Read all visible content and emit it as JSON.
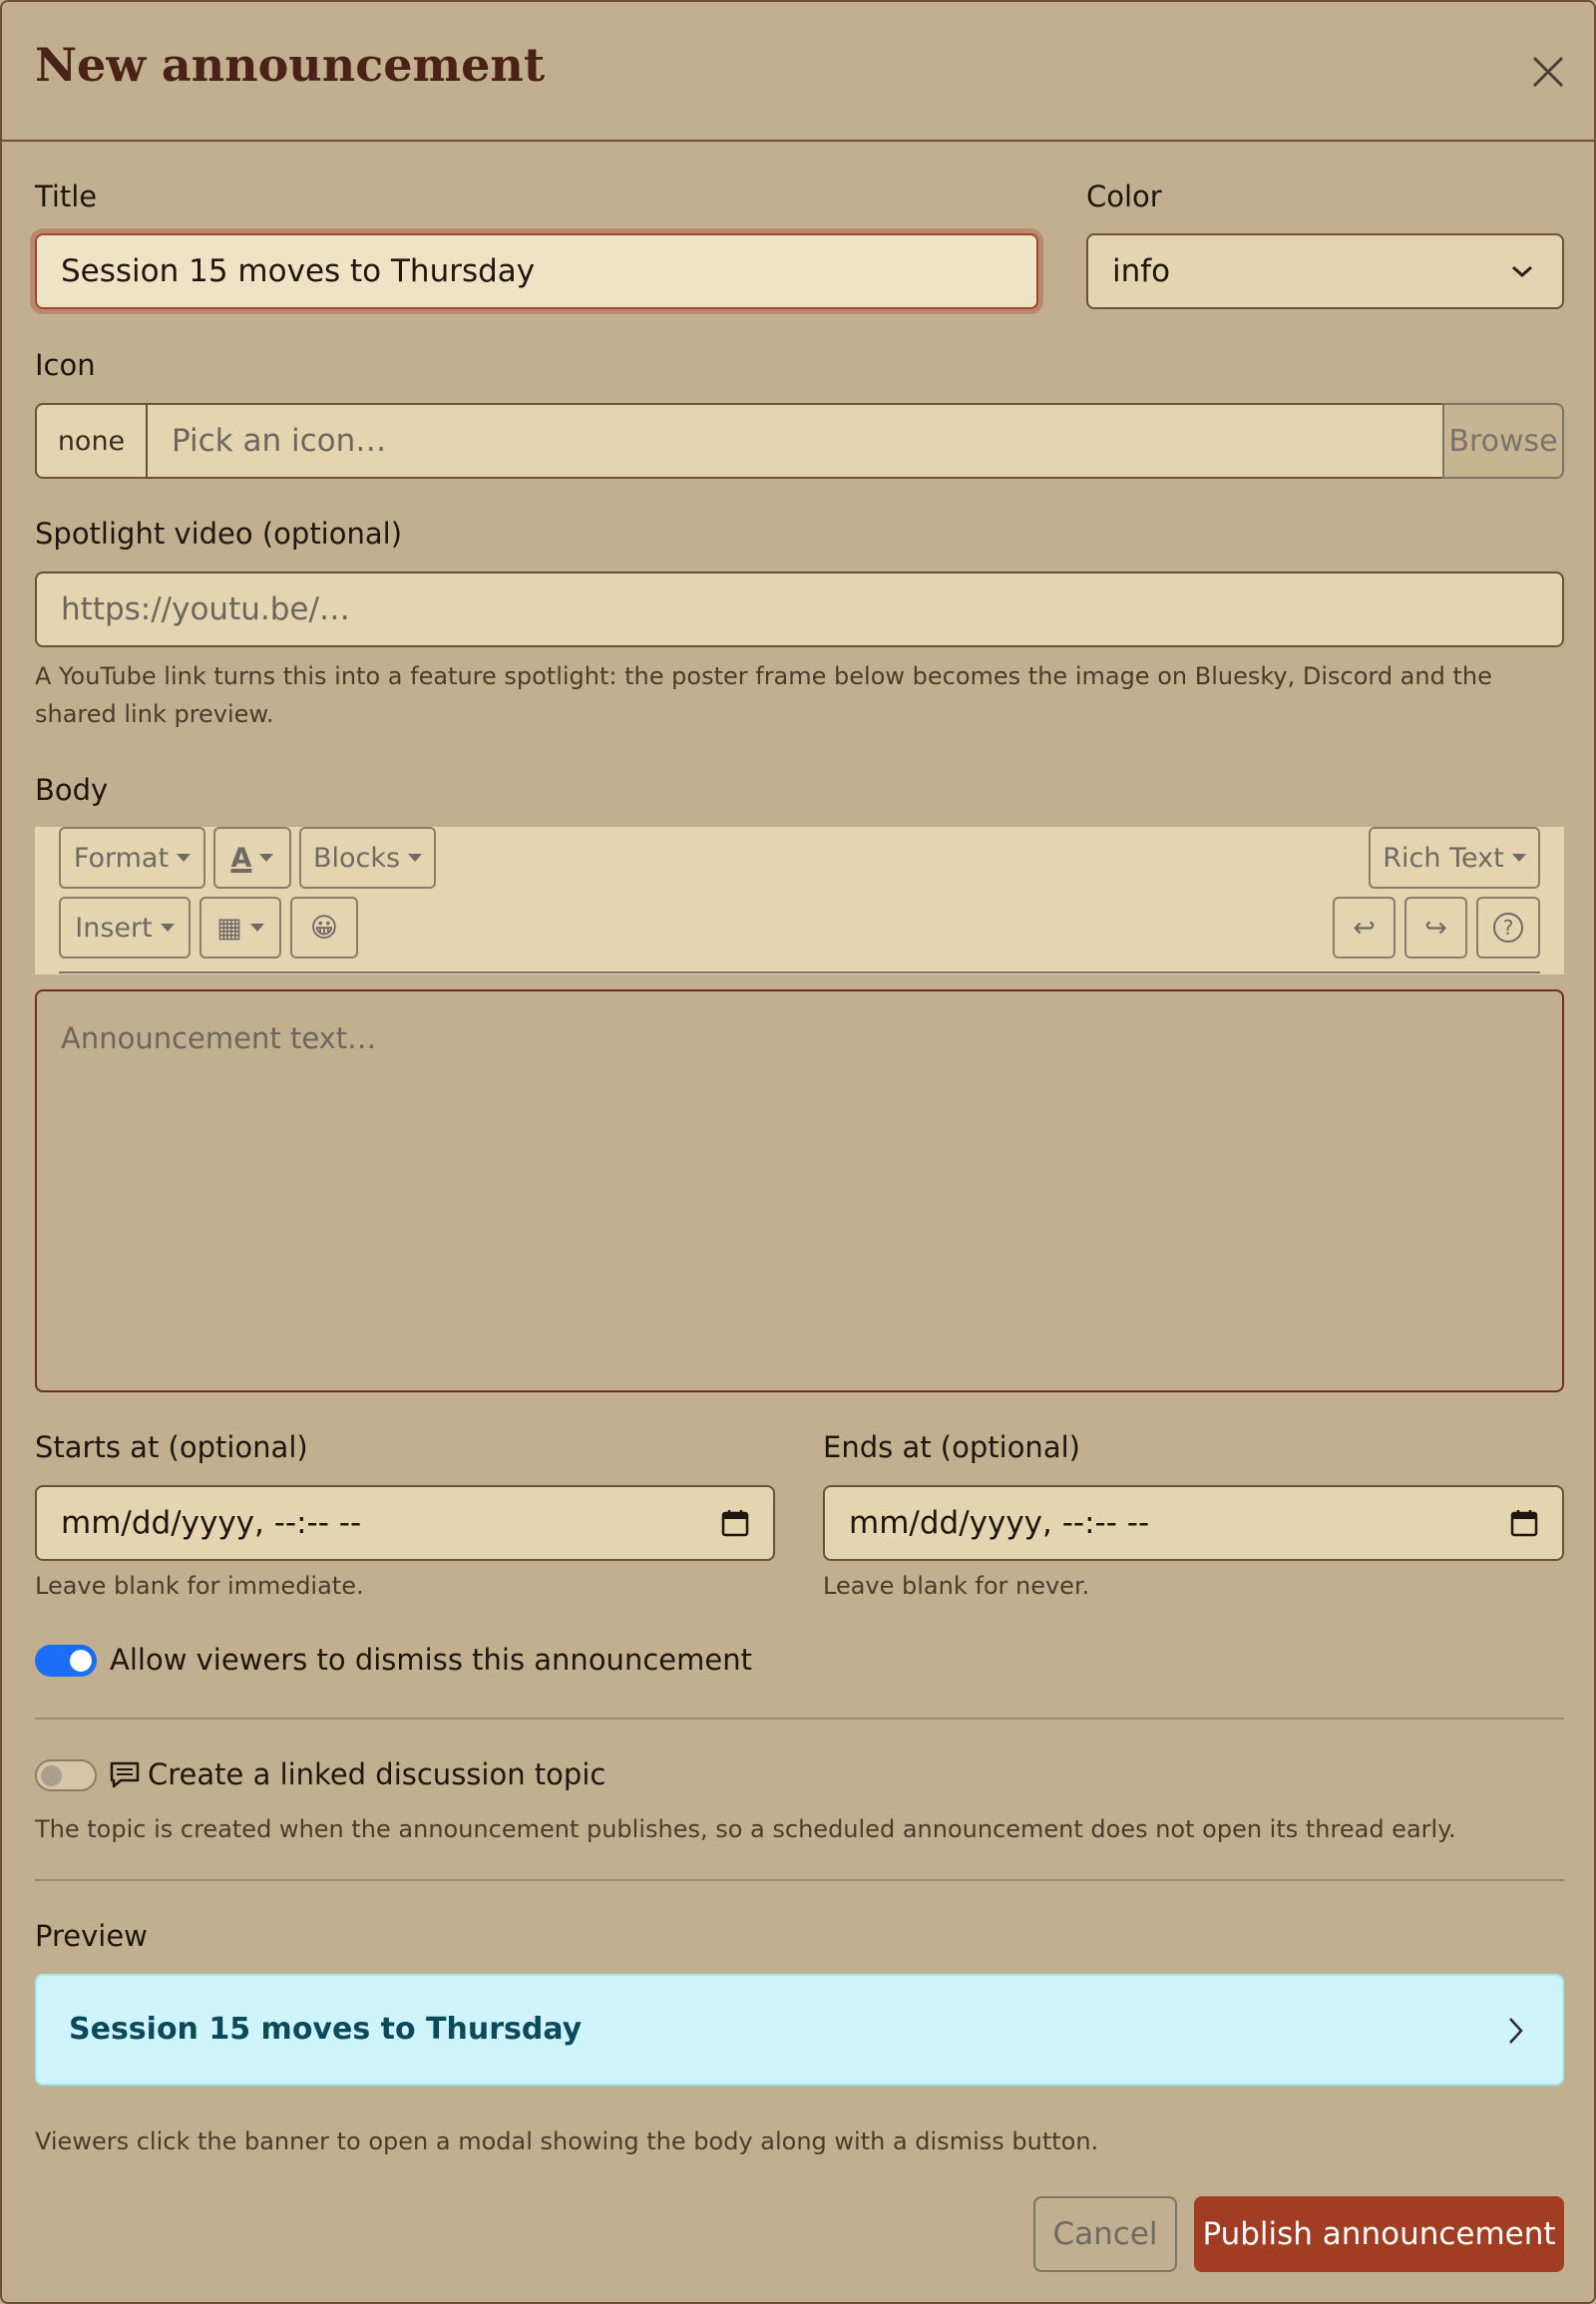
{
  "modal": {
    "title": "New announcement"
  },
  "form": {
    "title_label": "Title",
    "title_value": "Session 15 moves to Thursday",
    "color_label": "Color",
    "color_value": "info",
    "icon_label": "Icon",
    "icon_prefix": "none",
    "icon_placeholder": "Pick an icon…",
    "icon_browse": "Browse",
    "video_label": "Spotlight video (optional)",
    "video_placeholder": "https://youtu.be/…",
    "video_help": "A YouTube link turns this into a feature spotlight: the poster frame below becomes the image on Bluesky, Discord and the shared link preview.",
    "body_label": "Body",
    "body_placeholder": "Announcement text…",
    "starts_label": "Starts at (optional)",
    "starts_value": "mm/dd/yyyy, --:-- --",
    "starts_help": "Leave blank for immediate.",
    "ends_label": "Ends at (optional)",
    "ends_value": "mm/dd/yyyy, --:-- --",
    "ends_help": "Leave blank for never.",
    "dismiss_label": "Allow viewers to dismiss this announcement",
    "dismiss_on": true,
    "topic_label": "Create a linked discussion topic",
    "topic_on": false,
    "topic_help": "The topic is created when the announcement publishes, so a scheduled announcement does not open its thread early."
  },
  "toolbar": {
    "format": "Format",
    "text_color": "A",
    "blocks": "Blocks",
    "mode": "Rich Text",
    "insert": "Insert",
    "table": "▦",
    "emoji": "😀",
    "undo": "↩",
    "redo": "↪",
    "help": "?"
  },
  "preview": {
    "label": "Preview",
    "banner_title": "Session 15 moves to Thursday",
    "help": "Viewers click the banner to open a modal showing the body along with a dismiss button."
  },
  "actions": {
    "cancel": "Cancel",
    "publish": "Publish announcement"
  },
  "colors": {
    "accent": "#a13d22",
    "toggle_on": "#1a6ef5",
    "preview_bg": "#cff4fc",
    "preview_text": "#0b4a5a"
  }
}
